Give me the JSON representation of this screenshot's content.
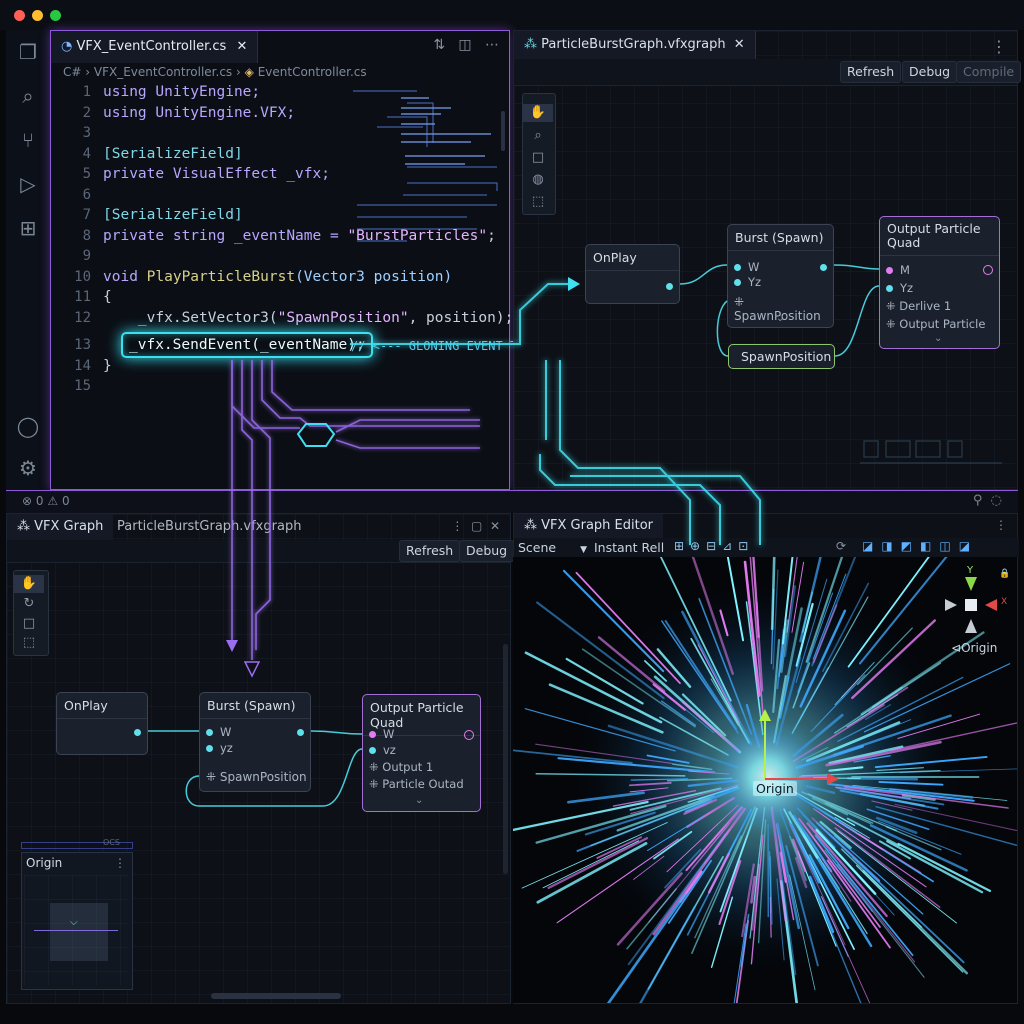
{
  "editor": {
    "tab_label": "VFX_EventController.cs",
    "breadcrumb": [
      "C#",
      "VFX_EventController.cs",
      "EventController.cs"
    ],
    "line_numbers": [
      "1",
      "2",
      "3",
      "4",
      "5",
      "6",
      "7",
      "8",
      "9",
      "10",
      "11",
      "12",
      "13",
      "14",
      "15"
    ],
    "code": {
      "l1": "using UnityEngine;",
      "l2": "using UnityEngine.VFX;",
      "l4": "[SerializeField]",
      "l5": "private VisualEffect _vfx;",
      "l7": "[SerializeField]",
      "l8a": "private string _eventName = ",
      "l8b": "\"BurstParticles\"",
      "l8c": ";",
      "l10a": "void ",
      "l10b": "PlayParticleBurst",
      "l10c": "(Vector3 position)",
      "l11": "{",
      "l12a": "    _vfx.SetVector3(",
      "l12b": "\"SpawnPosition\"",
      "l12c": ", position);",
      "l13": "_vfx.SendEvent(_eventName);",
      "l13_comment": "// <--- GLONING EVENT TRIGGER",
      "l14": "}"
    }
  },
  "status": {
    "errors": "0",
    "warnings": "0"
  },
  "graph_top": {
    "tab_label": "ParticleBurstGraph.vfxgraph",
    "buttons": {
      "refresh": "Refresh",
      "debug": "Debug",
      "compile": "Compile"
    },
    "nodes": {
      "onplay": "OnPlay",
      "burst": "Burst (Spawn)",
      "burst_w": "W",
      "burst_yz": "Yz",
      "burst_spawn": "SpawnPosition",
      "output_title": "Output Particle Quad",
      "output_m": "M",
      "output_yz": "Yz",
      "output_derive": "Derlive 1",
      "output_particle": "Output Particle",
      "spawn_param": "SpawnPosition"
    }
  },
  "graph_bottom": {
    "tab_vfx": "VFX Graph",
    "tab_file": "ParticleBurstGraph.vfxgraph",
    "buttons": {
      "refresh": "Refresh",
      "debug": "Debug"
    },
    "nodes": {
      "onplay": "OnPlay",
      "burst": "Burst (Spawn)",
      "burst_w": "W",
      "burst_yz": "yz",
      "burst_spawn": "SpawnPosition",
      "output_title": "Output Particle Quad",
      "output_w": "W",
      "output_vz": "vz",
      "output_1": "Output 1",
      "output_2": "Particle Outad"
    },
    "minimap_title": "Origin",
    "minimap_tag": "OCS"
  },
  "scene": {
    "tab_label": "VFX Graph Editor",
    "scene_select": "Scene",
    "mode_label": "Instant Rell",
    "gizmo_y": "Y",
    "gizmo_x": "X",
    "gizmo_origin": "Origin",
    "origin_label": "Origin"
  },
  "colors": {
    "accent_purple": "#8f5ad8",
    "accent_cyan": "#39e1f0",
    "magenta": "#e37cf2"
  }
}
